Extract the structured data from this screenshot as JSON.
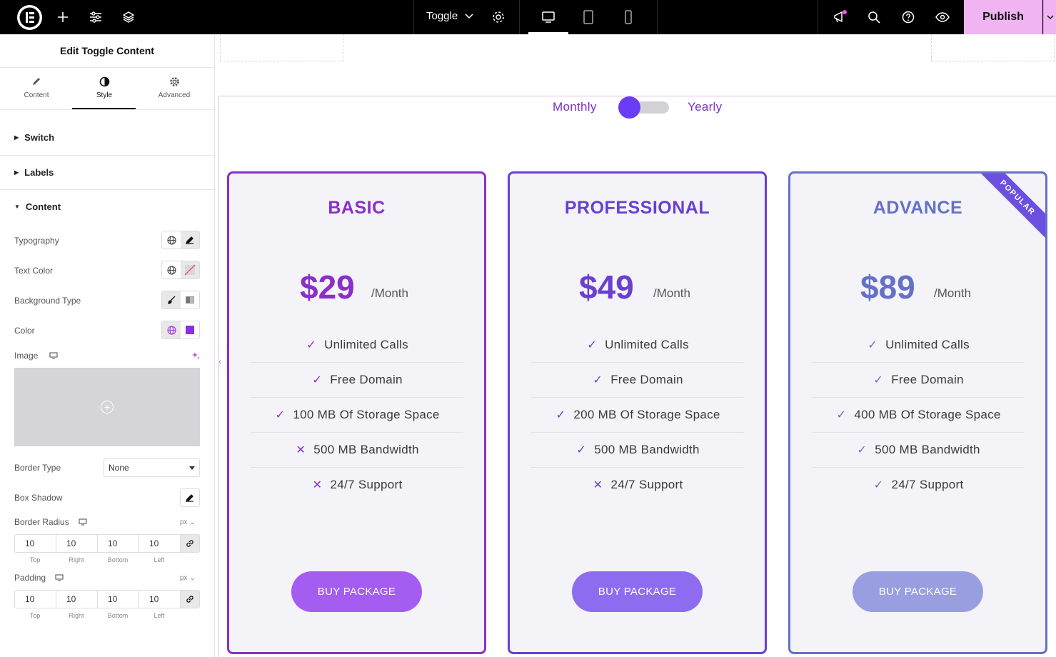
{
  "topbar": {
    "doc_name": "Toggle",
    "publish_label": "Publish",
    "icons": [
      "elementor-logo-icon",
      "plus-icon",
      "sliders-icon",
      "layers-icon",
      "chevron-down-icon",
      "gear-icon",
      "desktop-icon",
      "tablet-icon",
      "mobile-icon",
      "megaphone-icon",
      "search-icon",
      "help-icon",
      "eye-icon"
    ],
    "notification_color": "#f050f8"
  },
  "panel": {
    "title": "Edit Toggle Content",
    "tabs": [
      {
        "label": "Content",
        "icon": "pencil-icon"
      },
      {
        "label": "Style",
        "icon": "half-circle-icon"
      },
      {
        "label": "Advanced",
        "icon": "gear-icon"
      }
    ],
    "active_tab": "Style",
    "sections": [
      {
        "label": "Switch",
        "expanded": false
      },
      {
        "label": "Labels",
        "expanded": false
      },
      {
        "label": "Content",
        "expanded": true
      }
    ],
    "controls": {
      "typography": "Typography",
      "text_color": "Text Color",
      "background_type": "Background Type",
      "color": "Color",
      "color_swatch": "#8b2ee6",
      "image": "Image",
      "border_type": "Border Type",
      "border_type_value": "None",
      "box_shadow": "Box Shadow",
      "border_radius": "Border Radius",
      "padding": "Padding",
      "unit": "px",
      "dim_labels": [
        "Top",
        "Right",
        "Bottom",
        "Left"
      ],
      "border_radius_values": [
        "10",
        "10",
        "10",
        "10"
      ],
      "padding_values": [
        "10",
        "10",
        "10",
        "10"
      ]
    }
  },
  "toggle": {
    "left_label": "Monthly",
    "right_label": "Yearly",
    "state": "Monthly",
    "knob_color": "#6b3cf5"
  },
  "cards": [
    {
      "title": "BASIC",
      "price": "$29",
      "period": "/Month",
      "accent": "#8b2fc9",
      "button_label": "BUY PACKAGE",
      "button_color": "#a55cf0",
      "features": [
        {
          "text": "Unlimited Calls",
          "included": true
        },
        {
          "text": "Free Domain",
          "included": true
        },
        {
          "text": "100 MB Of Storage Space",
          "included": true
        },
        {
          "text": "500 MB Bandwidth",
          "included": false
        },
        {
          "text": "24/7 Support",
          "included": false
        }
      ]
    },
    {
      "title": "PROFESSIONAL",
      "price": "$49",
      "period": "/Month",
      "accent": "#6a3fd2",
      "button_label": "BUY PACKAGE",
      "button_color": "#8e6cf0",
      "features": [
        {
          "text": "Unlimited Calls",
          "included": true
        },
        {
          "text": "Free Domain",
          "included": true
        },
        {
          "text": "200 MB Of Storage Space",
          "included": true
        },
        {
          "text": "500 MB Bandwidth",
          "included": true
        },
        {
          "text": "24/7 Support",
          "included": false
        }
      ]
    },
    {
      "title": "ADVANCE",
      "price": "$89",
      "period": "/Month",
      "accent": "#6570c8",
      "button_label": "BUY PACKAGE",
      "button_color": "#989ee0",
      "badge": "POPULAR",
      "features": [
        {
          "text": "Unlimited Calls",
          "included": true
        },
        {
          "text": "Free Domain",
          "included": true
        },
        {
          "text": "400 MB Of Storage Space",
          "included": true
        },
        {
          "text": "500 MB Bandwidth",
          "included": true
        },
        {
          "text": "24/7 Support",
          "included": true
        }
      ]
    }
  ]
}
